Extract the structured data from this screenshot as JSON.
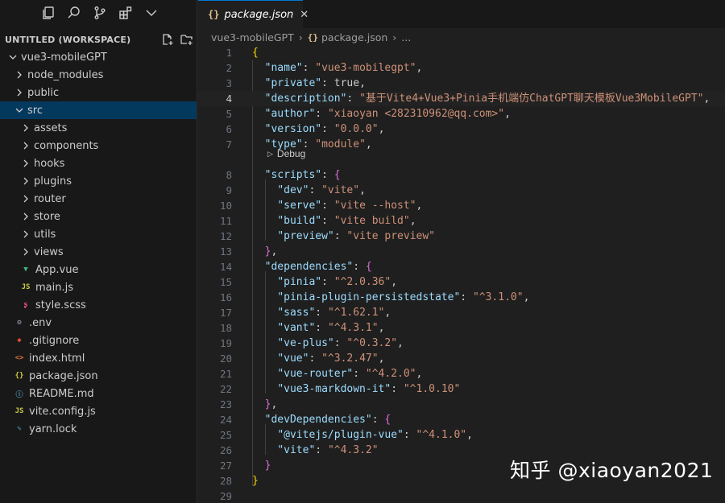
{
  "explorer": {
    "workspace_title": "UNTITLED (WORKSPACE)",
    "items": [
      {
        "label": "vue3-mobileGPT",
        "level": 0,
        "type": "folder-open"
      },
      {
        "label": "node_modules",
        "level": 1,
        "type": "folder"
      },
      {
        "label": "public",
        "level": 1,
        "type": "folder"
      },
      {
        "label": "src",
        "level": 1,
        "type": "folder-open",
        "selected": true
      },
      {
        "label": "assets",
        "level": 2,
        "type": "folder"
      },
      {
        "label": "components",
        "level": 2,
        "type": "folder"
      },
      {
        "label": "hooks",
        "level": 2,
        "type": "folder"
      },
      {
        "label": "plugins",
        "level": 2,
        "type": "folder"
      },
      {
        "label": "router",
        "level": 2,
        "type": "folder"
      },
      {
        "label": "store",
        "level": 2,
        "type": "folder"
      },
      {
        "label": "utils",
        "level": 2,
        "type": "folder"
      },
      {
        "label": "views",
        "level": 2,
        "type": "folder"
      },
      {
        "label": "App.vue",
        "level": 2,
        "type": "file",
        "icon": "vue-icon"
      },
      {
        "label": "main.js",
        "level": 2,
        "type": "file",
        "icon": "js-icon"
      },
      {
        "label": "style.scss",
        "level": 2,
        "type": "file",
        "icon": "sass-icon"
      },
      {
        "label": ".env",
        "level": 1,
        "type": "file",
        "icon": "gear-icon"
      },
      {
        "label": ".gitignore",
        "level": 1,
        "type": "file",
        "icon": "git-icon"
      },
      {
        "label": "index.html",
        "level": 1,
        "type": "file",
        "icon": "html-icon"
      },
      {
        "label": "package.json",
        "level": 1,
        "type": "file",
        "icon": "json-icon"
      },
      {
        "label": "README.md",
        "level": 1,
        "type": "file",
        "icon": "info-icon"
      },
      {
        "label": "vite.config.js",
        "level": 1,
        "type": "file",
        "icon": "js-icon"
      },
      {
        "label": "yarn.lock",
        "level": 1,
        "type": "file",
        "icon": "yarn-icon"
      }
    ]
  },
  "tab": {
    "label": "package.json",
    "icon": "{}",
    "close": "✕"
  },
  "breadcrumbs": {
    "folder": "vue3-mobileGPT",
    "icon": "{}",
    "file": "package.json",
    "more": "..."
  },
  "editor": {
    "active_line": 4,
    "codelens": "Debug",
    "lines": [
      "{",
      "  \"name\": \"vue3-mobilegpt\",",
      "  \"private\": true,",
      "  \"description\": \"基于Vite4+Vue3+Pinia手机端仿ChatGPT聊天模板Vue3MobileGPT\",",
      "  \"author\": \"xiaoyan <282310962@qq.com>\",",
      "  \"version\": \"0.0.0\",",
      "  \"type\": \"module\",",
      "  \"scripts\": {",
      "    \"dev\": \"vite\",",
      "    \"serve\": \"vite --host\",",
      "    \"build\": \"vite build\",",
      "    \"preview\": \"vite preview\"",
      "  },",
      "  \"dependencies\": {",
      "    \"pinia\": \"^2.0.36\",",
      "    \"pinia-plugin-persistedstate\": \"^3.1.0\",",
      "    \"sass\": \"^1.62.1\",",
      "    \"vant\": \"^4.3.1\",",
      "    \"ve-plus\": \"^0.3.2\",",
      "    \"vue\": \"^3.2.47\",",
      "    \"vue-router\": \"^4.2.0\",",
      "    \"vue3-markdown-it\": \"^1.0.10\"",
      "  },",
      "  \"devDependencies\": {",
      "    \"@vitejs/plugin-vue\": \"^4.1.0\",",
      "    \"vite\": \"^4.3.2\"",
      "  }",
      "}",
      ""
    ]
  },
  "watermark": "知乎 @xiaoyan2021",
  "colors": {
    "accent": "#0078d4",
    "selection": "#04395e",
    "key": "#9cdcfe",
    "string": "#ce9178"
  }
}
